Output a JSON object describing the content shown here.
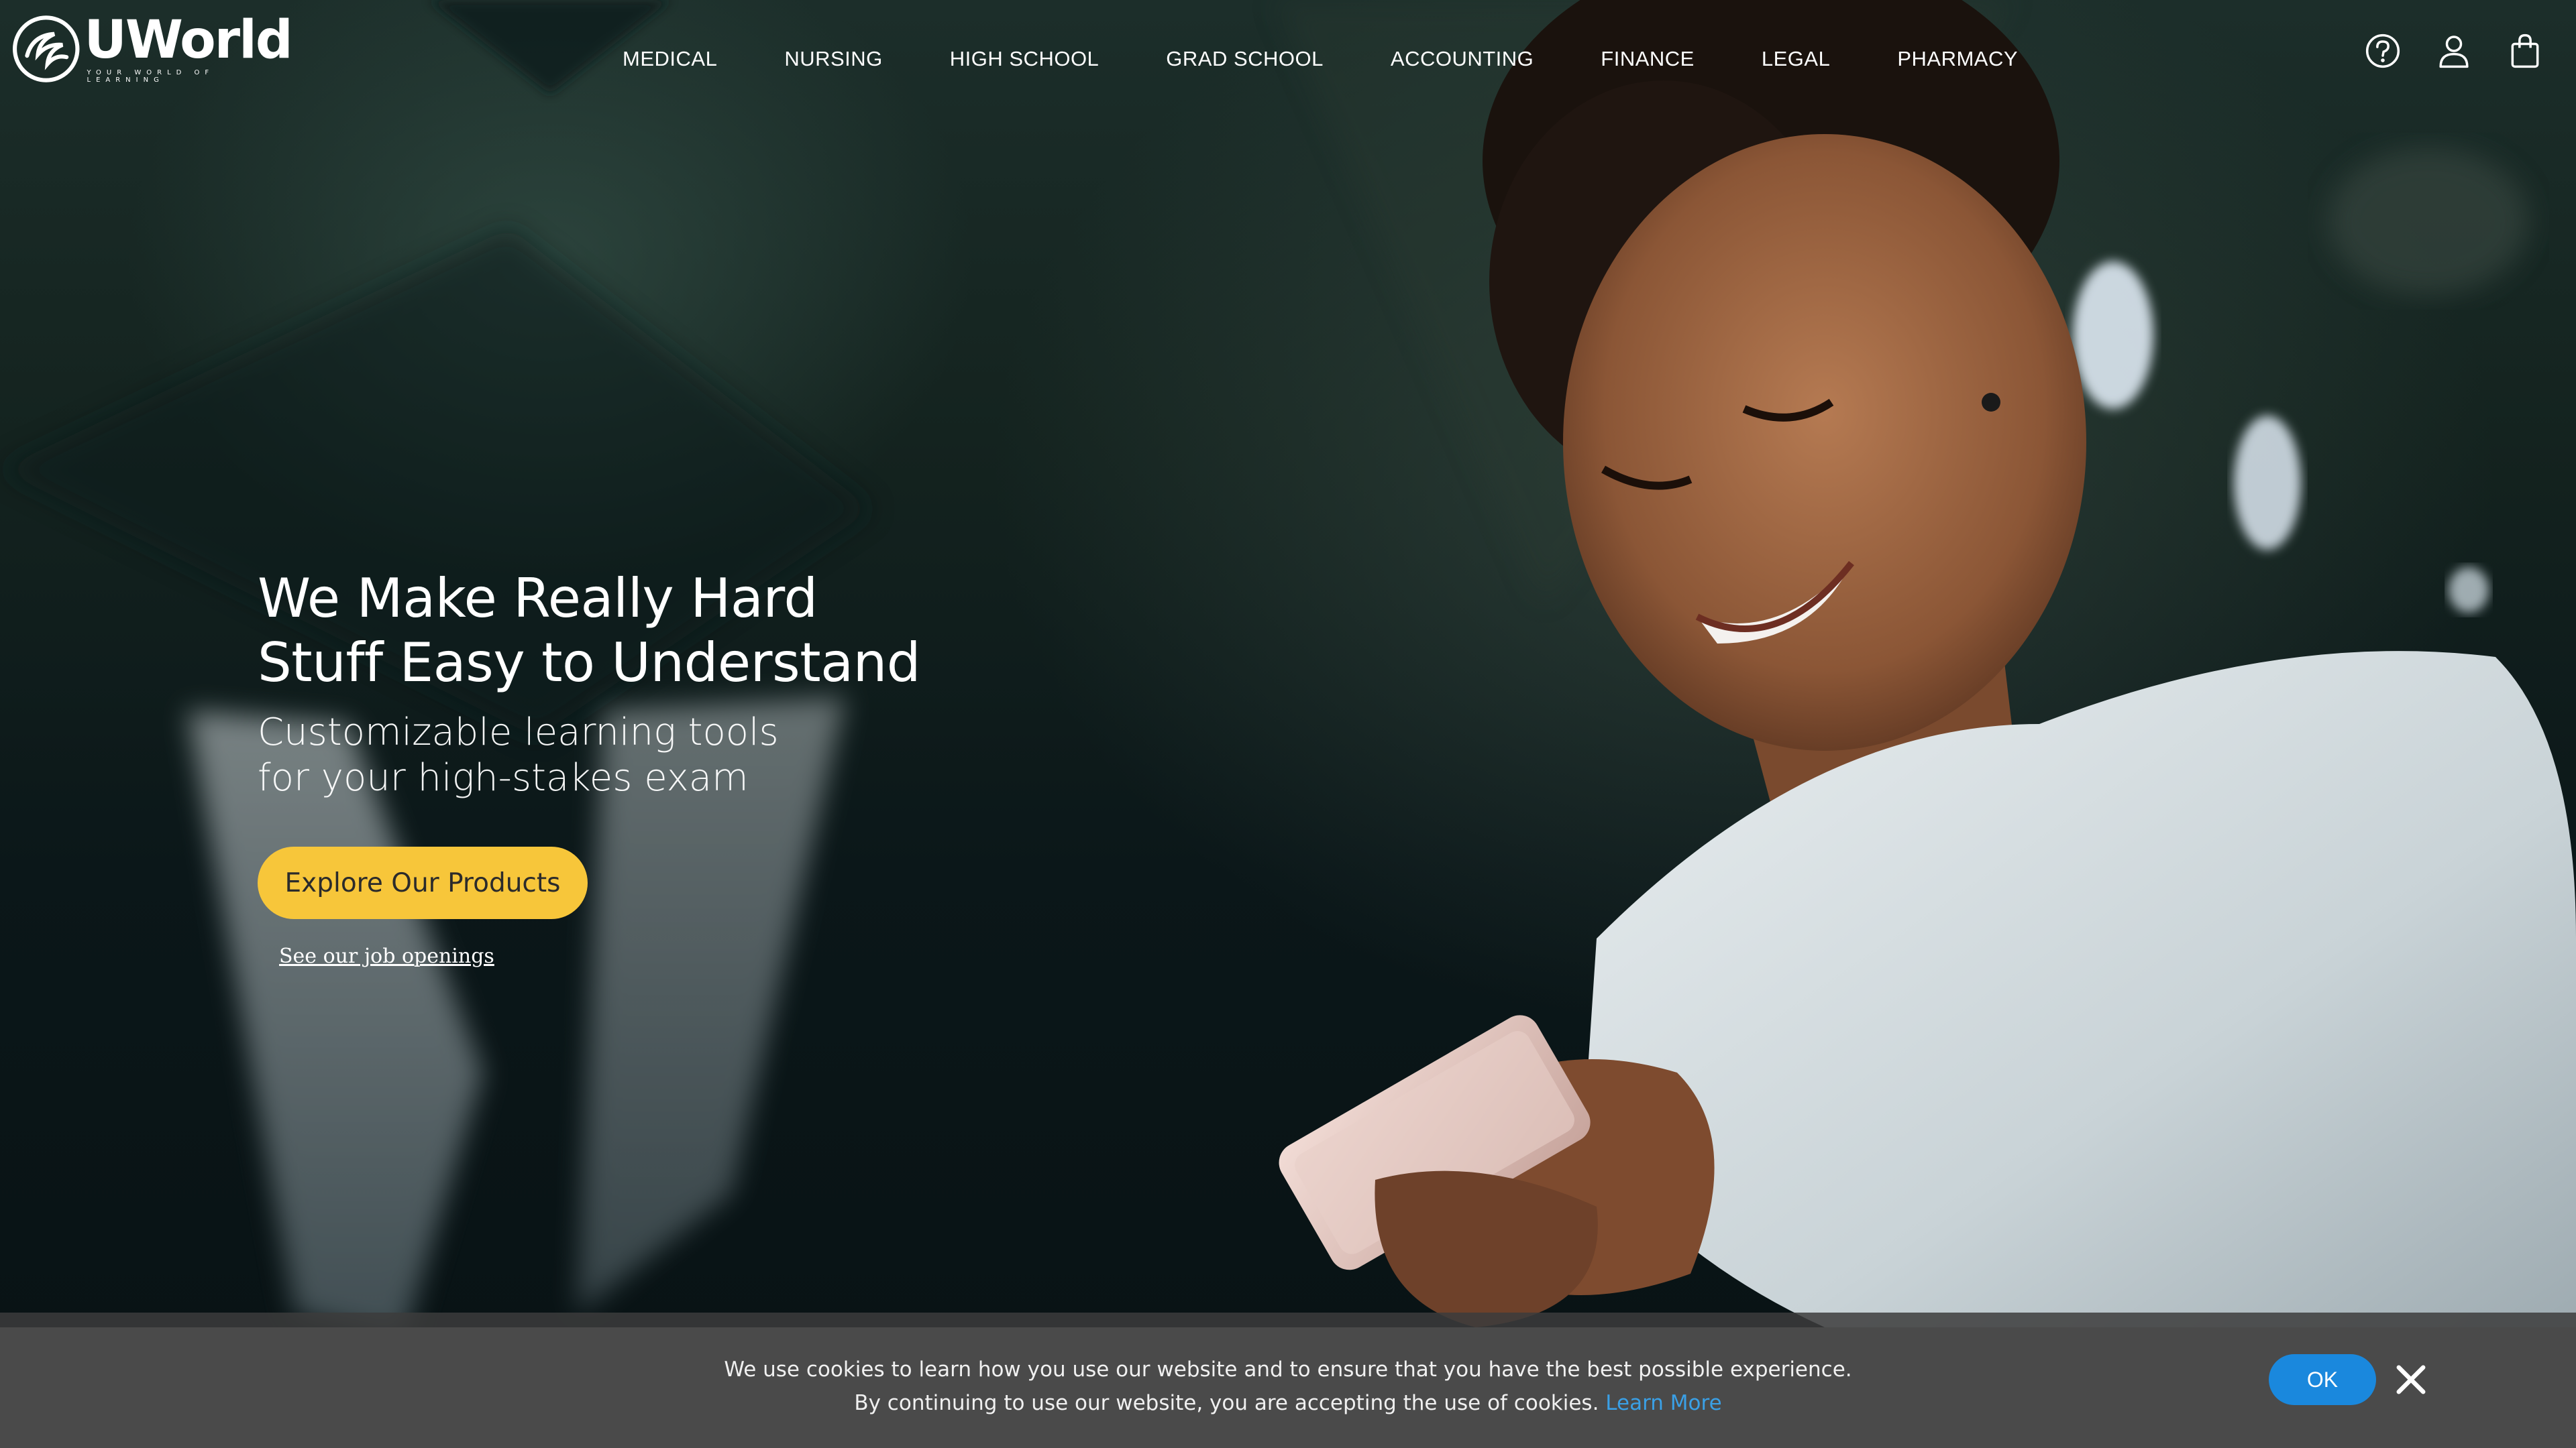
{
  "brand": {
    "name": "UWorld",
    "tagline": "YOUR WORLD OF LEARNING",
    "logo_icon": "globe-swirl-logo"
  },
  "nav": {
    "items": [
      "MEDICAL",
      "NURSING",
      "HIGH SCHOOL",
      "GRAD SCHOOL",
      "ACCOUNTING",
      "FINANCE",
      "LEGAL",
      "PHARMACY"
    ]
  },
  "utilities": [
    {
      "icon": "help-icon"
    },
    {
      "icon": "user-icon"
    },
    {
      "icon": "shopping-bag-icon"
    }
  ],
  "hero": {
    "headline_line1": "We Make Really Hard",
    "headline_line2": "Stuff Easy to Understand",
    "subhead_line1": "Customizable learning tools",
    "subhead_line2": "for your high-stakes exam",
    "cta_label": "Explore Our Products",
    "jobs_link": "See our job openings",
    "image_subject": "smiling woman looking at smartphone"
  },
  "cookie_banner": {
    "line1": "We use cookies to learn how you use our website and to ensure that you have the best possible experience.",
    "line2": "By continuing to use our website, you are accepting the use of cookies.",
    "learn_more": "Learn More",
    "ok_label": "OK",
    "close_icon": "close-icon"
  },
  "colors": {
    "cta": "#f7c63a",
    "ok_button": "#1a88dd",
    "link_blue": "#3aa0e6",
    "banner_bg": "#4a4a4a"
  }
}
